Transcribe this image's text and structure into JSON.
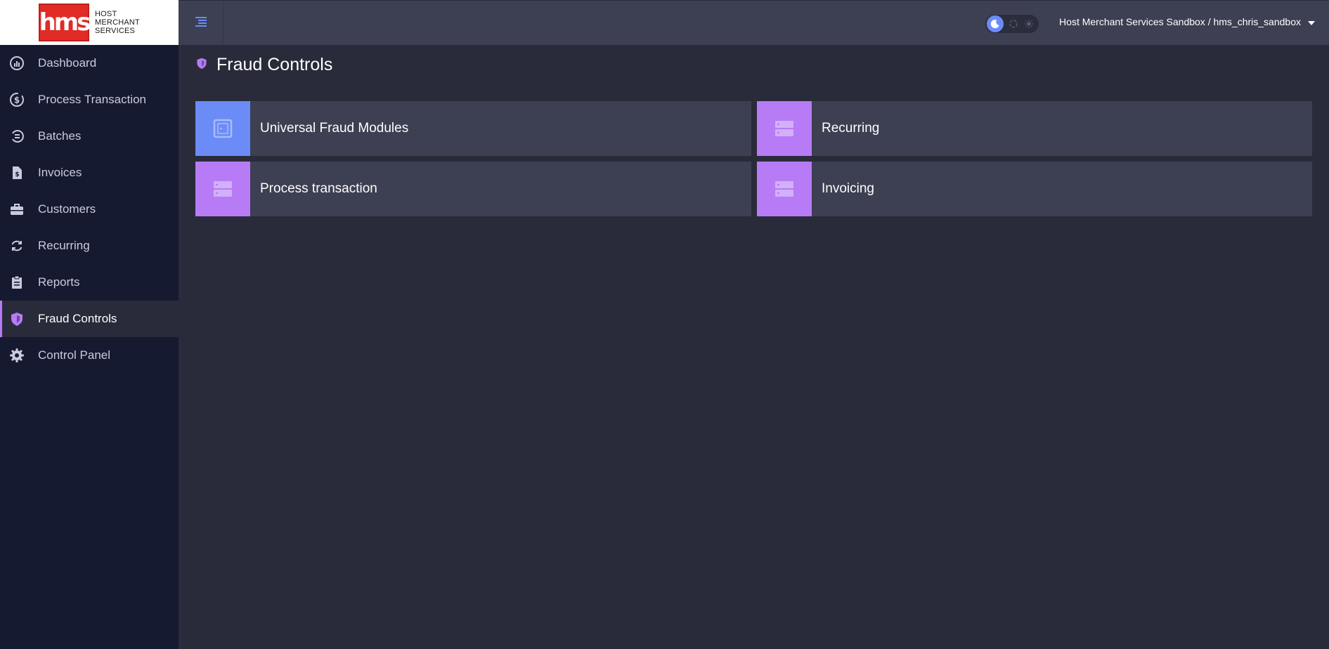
{
  "brand": {
    "logo_mark": "hms",
    "logo_lines": [
      "HOST",
      "MERCHANT",
      "SERVICES"
    ]
  },
  "sidebar": {
    "items": [
      {
        "label": "Dashboard",
        "icon": "gauge-icon"
      },
      {
        "label": "Process Transaction",
        "icon": "dollar-cycle-icon"
      },
      {
        "label": "Batches",
        "icon": "batch-icon"
      },
      {
        "label": "Invoices",
        "icon": "invoice-icon"
      },
      {
        "label": "Customers",
        "icon": "briefcase-icon"
      },
      {
        "label": "Recurring",
        "icon": "refresh-icon"
      },
      {
        "label": "Reports",
        "icon": "clipboard-icon"
      },
      {
        "label": "Fraud Controls",
        "icon": "shield-icon",
        "active": true
      },
      {
        "label": "Control Panel",
        "icon": "gear-icon"
      }
    ]
  },
  "header": {
    "account_label": "Host Merchant Services Sandbox / hms_chris_sandbox",
    "theme_mode": "dark"
  },
  "main": {
    "title": "Fraud Controls",
    "cards": [
      {
        "label": "Universal Fraud Modules",
        "icon": "safe-icon",
        "color": "#6b8cf7"
      },
      {
        "label": "Recurring",
        "icon": "server-icon",
        "color": "#b77bf5"
      },
      {
        "label": "Process transaction",
        "icon": "server-icon",
        "color": "#b77bf5"
      },
      {
        "label": "Invoicing",
        "icon": "server-icon",
        "color": "#b77bf5"
      }
    ]
  },
  "colors": {
    "accent_purple": "#b77bf5",
    "accent_blue": "#6b8cf7",
    "sidebar_bg": "#161a30",
    "content_bg": "#292b3a",
    "panel_bg": "#3d3f52"
  }
}
